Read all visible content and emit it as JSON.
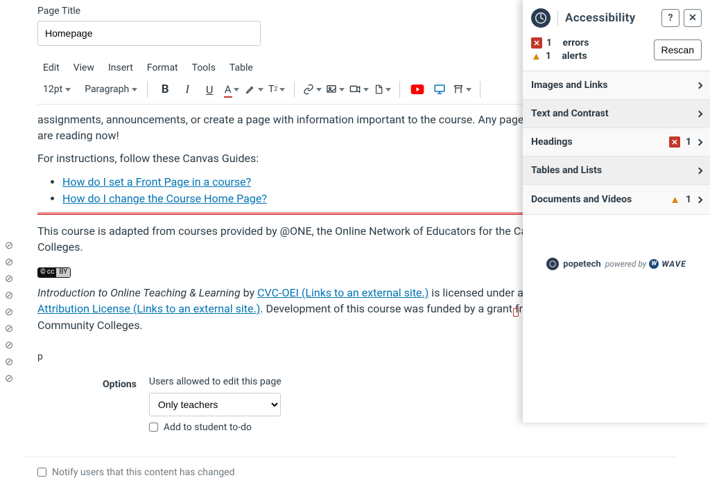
{
  "page": {
    "title_label": "Page Title",
    "title_value": "Homepage"
  },
  "menubar": {
    "edit": "Edit",
    "view": "View",
    "insert": "Insert",
    "format": "Format",
    "tools": "Tools",
    "table": "Table"
  },
  "toolbar": {
    "font_size": "12pt",
    "block": "Paragraph"
  },
  "content": {
    "p1": "assignments, announcements, or create a page with information important to the course. Any page can become the page you are reading now!",
    "p2": "For instructions, follow these Canvas Guides:",
    "links": [
      "How do I set a Front Page in a course?",
      "How do I change the Course Home Page?"
    ],
    "p3": "This course is adapted from courses provided by @ONE, the Online Network of Educators for the California Community Colleges.",
    "cc_left": "cc",
    "cc_right": "BY",
    "attr1_lead": "Introduction to Online Teaching & Learning",
    "attr1_by": " by ",
    "attr1_link": "CVC-OEI (Links to an external site.)",
    "attr1_mid": " is licensed under a ",
    "attr1_cc_link": "Creative Commons Attribution License (Links to an external site.)",
    "attr1_tail": ". Development of this course was funded by a grant from the California Community Colleges."
  },
  "status": {
    "path": "p"
  },
  "options": {
    "label": "Options",
    "caption": "Users allowed to edit this page",
    "select_value": "Only teachers",
    "add_todo": "Add to student to-do"
  },
  "notify": {
    "label": "Notify users that this content has changed"
  },
  "panel": {
    "title": "Accessibility",
    "help": "?",
    "close": "✕",
    "errors_count": "1",
    "errors_word": "errors",
    "alerts_count": "1",
    "alerts_word": "alerts",
    "rescan": "Rescan",
    "items": [
      {
        "label": "Images and Links",
        "err": "",
        "alert": ""
      },
      {
        "label": "Text and Contrast",
        "err": "",
        "alert": ""
      },
      {
        "label": "Headings",
        "err": "1",
        "alert": ""
      },
      {
        "label": "Tables and Lists",
        "err": "",
        "alert": ""
      },
      {
        "label": "Documents and Videos",
        "err": "",
        "alert": "1"
      }
    ],
    "foot_brand": "popetech",
    "foot_powered": "powered by",
    "foot_wave": "WAVE"
  }
}
